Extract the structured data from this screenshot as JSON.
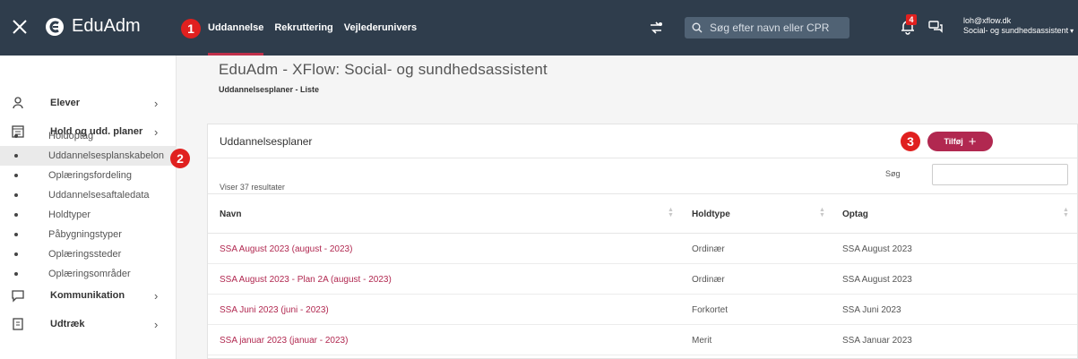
{
  "topbar": {
    "app_name": "EduAdm",
    "tabs": [
      "Uddannelse",
      "Rekruttering",
      "Vejlederunivers"
    ],
    "search_placeholder": "Søg efter navn eller CPR",
    "notification_count": "4",
    "user_email": "loh@xflow.dk",
    "user_role": "Social- og sundhedsassistent",
    "accent_color": "#c0304a",
    "bar_color": "#2f3d4c"
  },
  "markers": {
    "m1": "1",
    "m2": "2",
    "m3": "3"
  },
  "sidebar": {
    "main": [
      "Elever",
      "Hold og udd. planer",
      "Kommunikation",
      "Udtræk"
    ],
    "sub": [
      "Holdoptag",
      "Uddannelsesplanskabelon",
      "Oplæringsfordeling",
      "Uddannelsesaftaledata",
      "Holdtyper",
      "Påbygningstyper",
      "Oplæringssteder",
      "Oplæringsområder"
    ]
  },
  "page": {
    "title": "EduAdm - XFlow: Social- og sundhedsassistent",
    "breadcrumb": "Uddannelsesplaner - Liste"
  },
  "card": {
    "title": "Uddannelsesplaner",
    "add_label": "Tilføj",
    "results": "Viser 37 resultater",
    "search_label": "Søg",
    "columns": [
      "Navn",
      "Holdtype",
      "Optag"
    ],
    "rows": [
      [
        "SSA August 2023 (august - 2023)",
        "Ordinær",
        "SSA August 2023"
      ],
      [
        "SSA August 2023 - Plan 2A (august - 2023)",
        "Ordinær",
        "SSA August 2023"
      ],
      [
        "SSA Juni 2023 (juni - 2023)",
        "Forkortet",
        "SSA Juni 2023"
      ],
      [
        "SSA januar 2023 (januar - 2023)",
        "Merit",
        "SSA Januar 2023"
      ]
    ]
  }
}
